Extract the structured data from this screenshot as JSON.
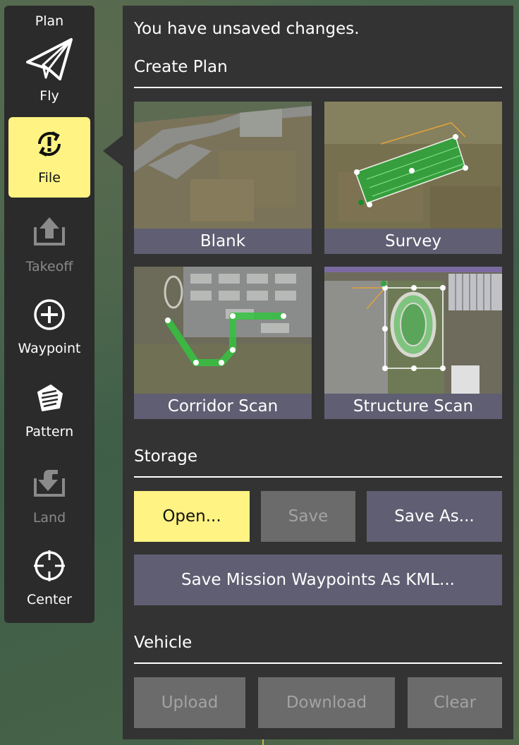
{
  "toolbar": {
    "items": [
      {
        "label": "Plan",
        "icon": "plan-label",
        "state": "normal"
      },
      {
        "label": "Fly",
        "icon": "paper-plane-icon",
        "state": "normal"
      },
      {
        "label": "File",
        "icon": "sync-file-icon",
        "state": "active"
      },
      {
        "label": "Takeoff",
        "icon": "takeoff-icon",
        "state": "disabled"
      },
      {
        "label": "Waypoint",
        "icon": "plus-circle-icon",
        "state": "normal"
      },
      {
        "label": "Pattern",
        "icon": "pattern-icon",
        "state": "normal"
      },
      {
        "label": "Land",
        "icon": "land-icon",
        "state": "disabled"
      },
      {
        "label": "Center",
        "icon": "crosshair-icon",
        "state": "normal"
      }
    ]
  },
  "panel": {
    "message": "You have unsaved changes.",
    "create_plan": {
      "title": "Create Plan",
      "tiles": [
        {
          "label": "Blank"
        },
        {
          "label": "Survey"
        },
        {
          "label": "Corridor Scan"
        },
        {
          "label": "Structure Scan"
        }
      ]
    },
    "storage": {
      "title": "Storage",
      "open": "Open...",
      "save": "Save",
      "save_as": "Save As...",
      "save_kml": "Save Mission Waypoints As KML..."
    },
    "vehicle": {
      "title": "Vehicle",
      "upload": "Upload",
      "download": "Download",
      "clear": "Clear"
    }
  },
  "colors": {
    "accent": "#fff383",
    "panel": "#333333",
    "toolbar": "#2b2b2b",
    "button": "#5f5e72",
    "button_disabled": "#6b6b6b"
  }
}
